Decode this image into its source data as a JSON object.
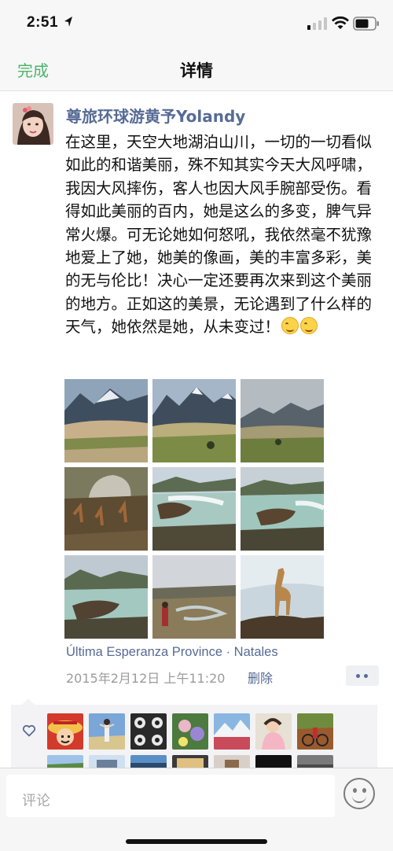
{
  "status_bar": {
    "time": "2:51",
    "icons": [
      "location-arrow-icon",
      "cellular-signal-icon",
      "wifi-icon",
      "battery-icon"
    ]
  },
  "nav": {
    "done_label": "完成",
    "title": "详情"
  },
  "post": {
    "author": "尊旅环球游黄予Yolandy",
    "text": "在这里，天空大地湖泊山川，一切的一切看似如此的和谐美丽，殊不知其实今天大风呼啸，我因大风摔伤，客人也因大风手腕部受伤。看得如此美丽的百内，她是这么的多变，脾气异常火爆。可无论她如何怒吼，我依然毫不犹豫地爱上了她，她美的像画，美的丰富多彩，美的无与伦比！决心一定还要再次来到这个美丽的地方。正如这的美景，无论遇到了什么样的天气，她依然是她，从未变过！",
    "emoji_count": 2,
    "photos": [
      {
        "subject": "mountains-and-dunes"
      },
      {
        "subject": "mountains-and-grassland"
      },
      {
        "subject": "cloudy-mountains-field"
      },
      {
        "subject": "guanacos-by-boulder"
      },
      {
        "subject": "waterfall-rocks"
      },
      {
        "subject": "waterfall-river"
      },
      {
        "subject": "waterfall-mountain"
      },
      {
        "subject": "person-and-river-valley"
      },
      {
        "subject": "guanaco-on-rock"
      }
    ],
    "location": "Última Esperanza Province · Natales",
    "timestamp": "2015年2月12日 上午11:20",
    "delete_label": "删除"
  },
  "likes": {
    "icon": "heart-outline-icon",
    "avatars": [
      "luffy",
      "landscape-person",
      "panda-pattern",
      "flowers",
      "mountain-lake",
      "child-photo",
      "bike-rider",
      "field",
      "sky",
      "jeep",
      "room",
      "group",
      "night",
      "city"
    ]
  },
  "comment_bar": {
    "placeholder": "评论",
    "emoji_icon": "smiley-face-icon"
  },
  "colors": {
    "accent_green": "#4cb56a",
    "link_blue": "#576b95"
  }
}
